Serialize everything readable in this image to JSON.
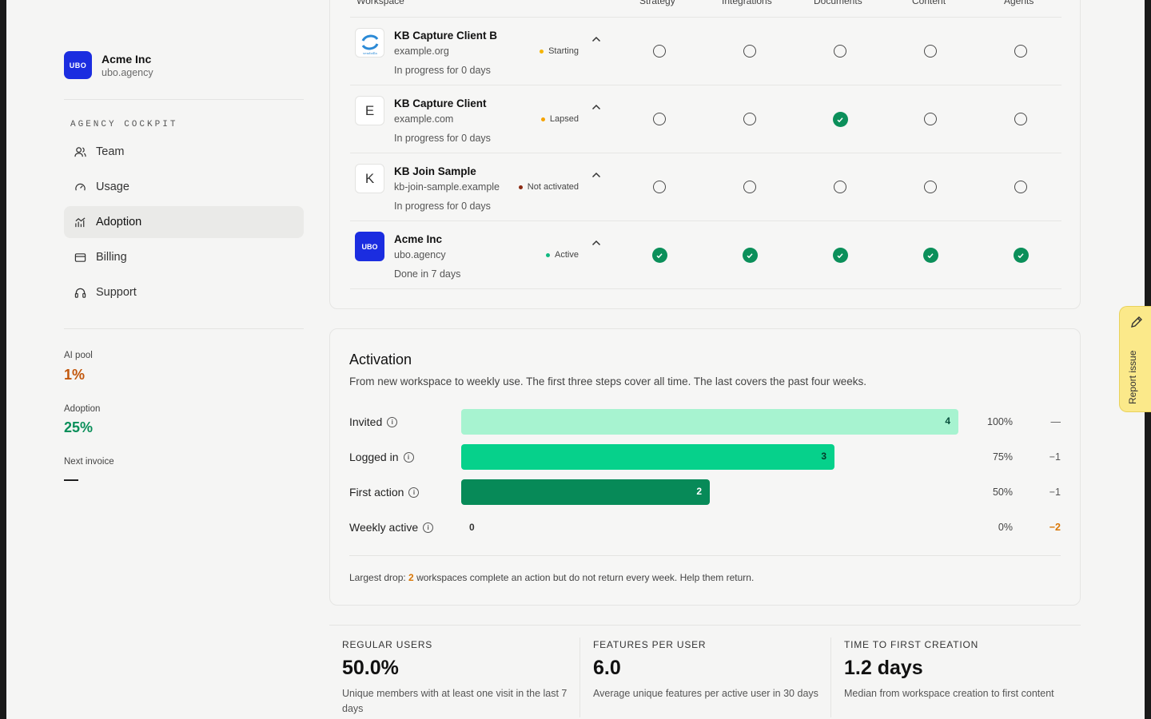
{
  "sidebar": {
    "org": {
      "name": "Acme Inc",
      "domain": "ubo.agency",
      "logo_text": "UBO"
    },
    "section_label": "AGENCY COCKPIT",
    "nav": [
      {
        "label": "Team",
        "icon": "users-icon"
      },
      {
        "label": "Usage",
        "icon": "gauge-icon"
      },
      {
        "label": "Adoption",
        "icon": "chart-icon",
        "active": true
      },
      {
        "label": "Billing",
        "icon": "card-icon"
      },
      {
        "label": "Support",
        "icon": "headset-icon"
      }
    ],
    "stats": [
      {
        "label": "AI pool",
        "value": "1%",
        "color": "#c2570c"
      },
      {
        "label": "Adoption",
        "value": "25%",
        "color": "#0b8f5a"
      },
      {
        "label": "Next invoice",
        "value": "—",
        "color": "#111111"
      }
    ]
  },
  "table": {
    "columns": [
      "Workspace",
      "Strategy",
      "Integrations",
      "Documents",
      "Content",
      "Agents"
    ],
    "rows": [
      {
        "name": "KB Capture Client B",
        "domain": "example.org",
        "status": "Starting",
        "status_color": "#f5b400",
        "progress": "In progress for 0 days",
        "logo": "sendzilla",
        "steps": [
          false,
          false,
          false,
          false,
          false
        ]
      },
      {
        "name": "KB Capture Client",
        "domain": "example.com",
        "status": "Lapsed",
        "status_color": "#f5a300",
        "progress": "In progress for 0 days",
        "logo": "E",
        "steps": [
          false,
          false,
          true,
          false,
          false
        ]
      },
      {
        "name": "KB Join Sample",
        "domain": "kb-join-sample.example",
        "status": "Not activated",
        "status_color": "#8b2a12",
        "progress": "In progress for 0 days",
        "logo": "K",
        "steps": [
          false,
          false,
          false,
          false,
          false
        ]
      },
      {
        "name": "Acme Inc",
        "domain": "ubo.agency",
        "status": "Active",
        "status_color": "#10b981",
        "progress": "Done in 7 days",
        "logo": "UBO",
        "steps": [
          true,
          true,
          true,
          true,
          true
        ]
      }
    ]
  },
  "activation": {
    "title": "Activation",
    "subtitle": "From new workspace to weekly use. The first three steps cover all time. The last covers the past four weeks.",
    "steps": [
      {
        "label": "Invited",
        "count": 4,
        "pct": "100%",
        "delta": "—",
        "color": "#a7f3d0",
        "text_color": "#064e3b",
        "delta_color": "#555555"
      },
      {
        "label": "Logged in",
        "count": 3,
        "pct": "75%",
        "delta": "−1",
        "color": "#06d18b",
        "text_color": "#053a2a",
        "delta_color": "#555555"
      },
      {
        "label": "First action",
        "count": 2,
        "pct": "50%",
        "delta": "−1",
        "color": "#078a58",
        "text_color": "#ffffff",
        "delta_color": "#555555"
      },
      {
        "label": "Weekly active",
        "count": 0,
        "pct": "0%",
        "delta": "−2",
        "color": "#06d18b",
        "text_color": "#333333",
        "delta_color": "#d97706"
      }
    ],
    "max_count": 4,
    "footer_prefix": "Largest drop: ",
    "footer_number": "2",
    "footer_suffix": " workspaces complete an action but do not return every week. Help them return."
  },
  "metrics": [
    {
      "label": "REGULAR USERS",
      "value": "50.0%",
      "desc": "Unique members with at least one visit in the last 7 days"
    },
    {
      "label": "FEATURES PER USER",
      "value": "6.0",
      "desc": "Average unique features per active user in 30 days"
    },
    {
      "label": "TIME TO FIRST CREATION",
      "value": "1.2 days",
      "desc": "Median from workspace creation to first content"
    }
  ],
  "report_issue": {
    "label": "Report issue"
  }
}
